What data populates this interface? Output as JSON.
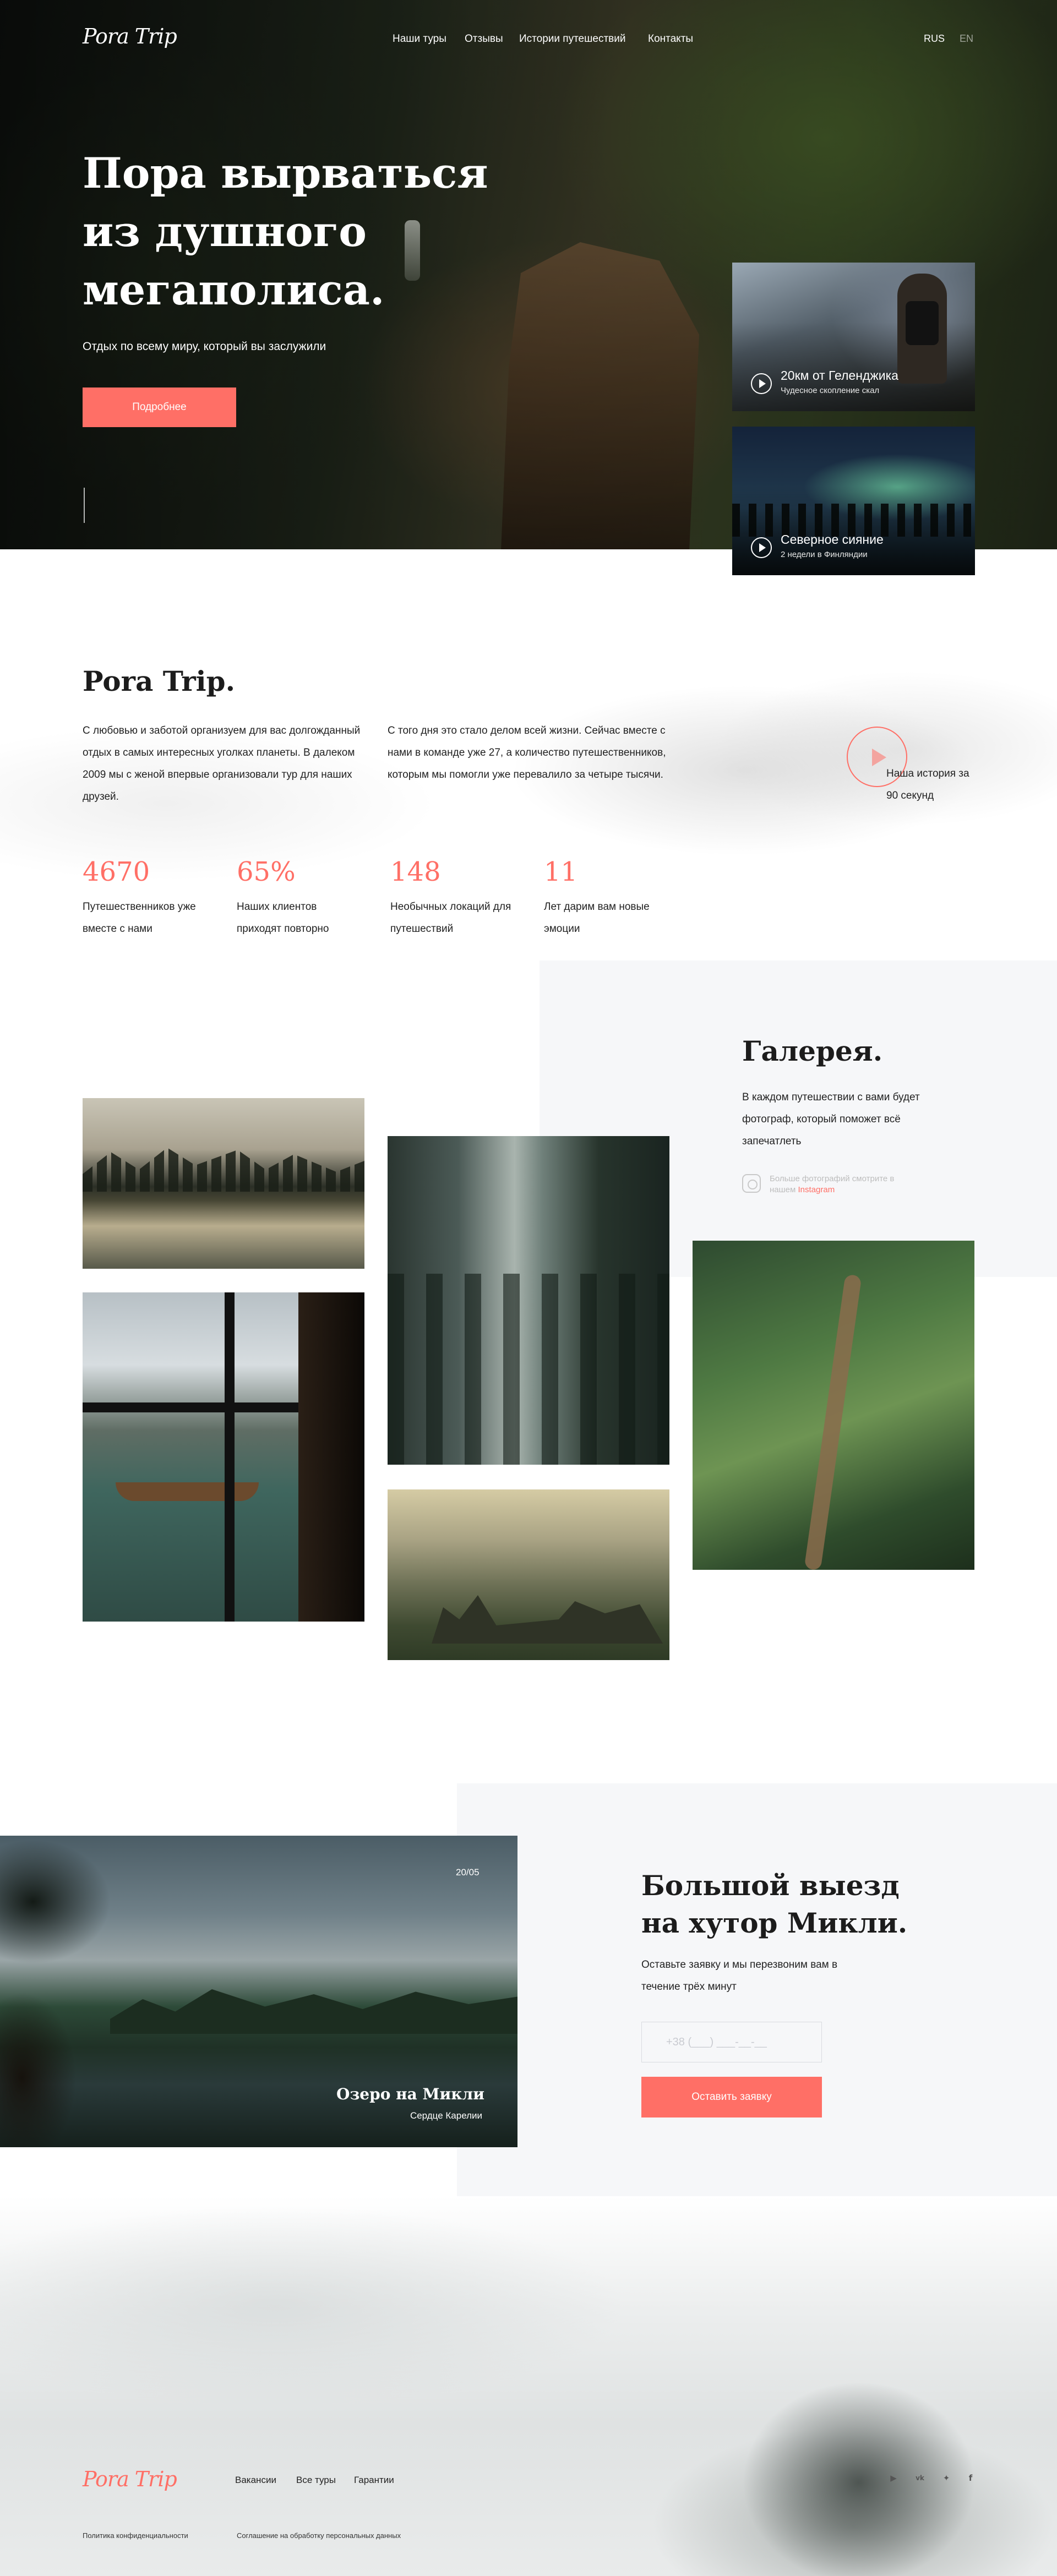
{
  "header": {
    "logo": "Pora Trip",
    "nav": [
      "Наши туры",
      "Отзывы",
      "Истории путешествий",
      "Контакты"
    ],
    "languages": [
      "RUS",
      "EN"
    ],
    "active_language": "RUS"
  },
  "hero": {
    "title": "Пора вырваться из душного мегаполиса.",
    "subtitle": "Отдых по всему миру, который вы заслужили",
    "button": "Подробнее",
    "cards": [
      {
        "title": "20км от Геленджика",
        "subtitle": "Чудесное скопление скал"
      },
      {
        "title": "Северное сияние",
        "subtitle": "2 недели в Финляндии"
      }
    ]
  },
  "about": {
    "title": "Pora Trip.",
    "paragraph_1": "С любовью и заботой организуем для вас долгожданный отдых в самых интересных уголках планеты. В далеком 2009 мы с женой впервые организовали тур для наших друзей.",
    "paragraph_2": "С того дня это стало делом всей жизни. Сейчас вместе с нами в команде уже 27, а количество путешественников, которым мы помогли уже перевалило за четыре тысячи.",
    "video_label": "Наша история за 90 секунд",
    "stats": [
      {
        "value": "4670",
        "label": "Путешественников уже вместе с нами"
      },
      {
        "value": "65%",
        "label": "Наших клиентов приходят повторно"
      },
      {
        "value": "148",
        "label": "Необычных локаций для путешествий"
      },
      {
        "value": "11",
        "label": "Лет дарим вам новые эмоции"
      }
    ]
  },
  "gallery": {
    "title": "Галерея.",
    "text": "В каждом путешествии с вами будет фотограф, который поможет всё запечатлеть",
    "instagram_text": "Больше фотографий смотрите в нашем",
    "instagram_link": "Instagram"
  },
  "tour": {
    "date": "20/05",
    "photo_title": "Озеро на Микли",
    "photo_subtitle": "Сердце Карелии",
    "title": "Большой выезд на хутор Микли.",
    "text": "Оставьте заявку и мы перезвоним вам в течение трёх минут",
    "phone_placeholder": "+38 (___) ___-__-__",
    "button": "Оставить заявку"
  },
  "footer": {
    "logo": "Pora Trip",
    "links": [
      "Вакансии",
      "Все туры",
      "Гарантии"
    ],
    "social_icons": [
      "youtube-icon",
      "vk-icon",
      "twitter-icon",
      "facebook-icon"
    ],
    "legal": [
      "Политика конфиденциальности",
      "Соглашение на обработку персональных данных"
    ]
  },
  "colors": {
    "accent": "#ff6f66",
    "panel": "#f6f7f9",
    "text": "#1c1c1c"
  }
}
